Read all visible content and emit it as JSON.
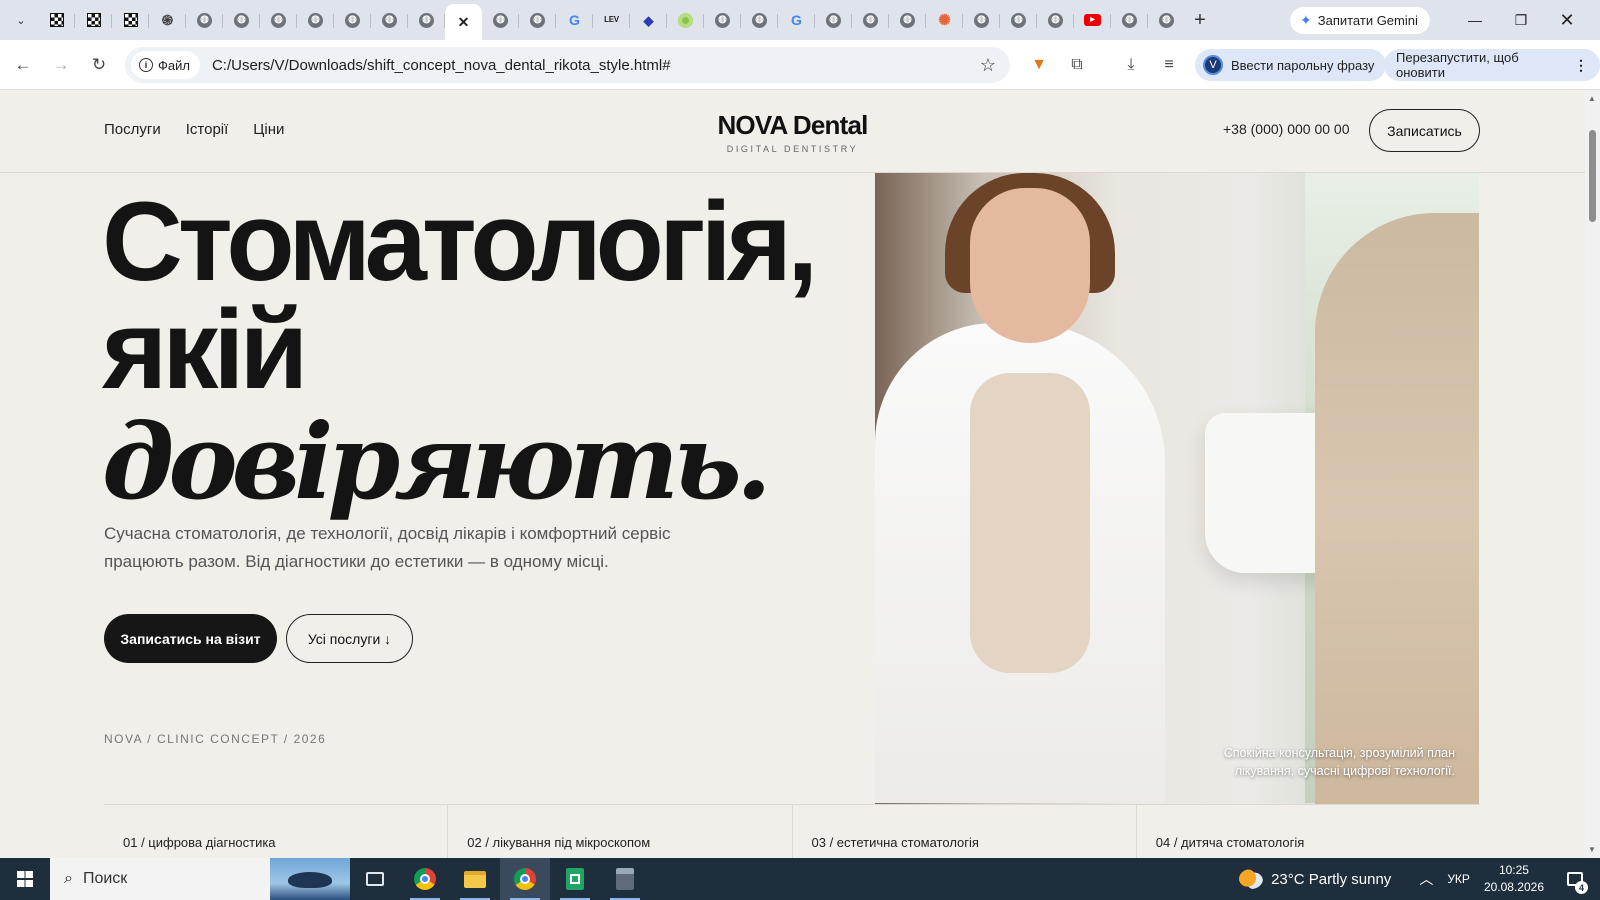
{
  "browser": {
    "tabs": [
      {
        "icon": "checker-favicon-icon"
      },
      {
        "icon": "checker-favicon-icon"
      },
      {
        "icon": "checker-favicon-icon"
      },
      {
        "icon": "spiral-favicon-icon"
      },
      {
        "icon": "globe-icon"
      },
      {
        "icon": "globe-icon"
      },
      {
        "icon": "globe-icon"
      },
      {
        "icon": "globe-icon"
      },
      {
        "icon": "globe-icon"
      },
      {
        "icon": "globe-icon"
      },
      {
        "icon": "globe-icon"
      },
      {
        "icon": "close-tab-icon",
        "active": true
      },
      {
        "icon": "globe-icon"
      },
      {
        "icon": "globe-icon"
      },
      {
        "icon": "google-g-icon"
      },
      {
        "icon": "lev-favicon-icon",
        "text": "LEV"
      },
      {
        "icon": "diamond-favicon-icon"
      },
      {
        "icon": "green-circle-favicon-icon"
      },
      {
        "icon": "globe-icon"
      },
      {
        "icon": "globe-icon"
      },
      {
        "icon": "google-g-icon"
      },
      {
        "icon": "globe-icon"
      },
      {
        "icon": "globe-icon"
      },
      {
        "icon": "globe-icon"
      },
      {
        "icon": "sunburst-favicon-icon"
      },
      {
        "icon": "globe-icon"
      },
      {
        "icon": "globe-icon"
      },
      {
        "icon": "globe-icon"
      },
      {
        "icon": "youtube-icon"
      },
      {
        "icon": "globe-icon"
      },
      {
        "icon": "globe-icon"
      }
    ],
    "gemini_label": "Запитати Gemini",
    "site_chip_label": "Файл",
    "url": "C:/Users/V/Downloads/shift_concept_nova_dental_rikota_style.html#",
    "passphrase_label": "Ввести парольну фразу",
    "profile_initial": "V",
    "restart_label": "Перезапустити, щоб оновити"
  },
  "site": {
    "nav": [
      "Послуги",
      "Історії",
      "Ціни"
    ],
    "logo": "NOVA Dental",
    "logo_sub": "DIGITAL DENTISTRY",
    "phone": "+38 (000) 000 00 00",
    "header_cta": "Записатись",
    "hero": {
      "line1": "Стоматологія,",
      "line2": "якій",
      "line3": "довіряють.",
      "description": "Сучасна стоматологія, де технології, досвід лікарів і комфортний сервіс працюють разом. Від діагностики до естетики — в одному місці.",
      "primary_cta": "Записатись на візит",
      "secondary_cta": "Усі послуги ↓",
      "meta": "NOVA / CLINIC CONCEPT / 2026",
      "photo_caption": "Спокійна консультація, зрозумілий план лікування, сучасні цифрові технології."
    },
    "services": [
      "01 / цифрова діагностика",
      "02 / лікування під мікроскопом",
      "03 / естетична стоматологія",
      "04 / дитяча стоматологія"
    ]
  },
  "taskbar": {
    "search_label": "Поиск",
    "weather": "23°C  Partly sunny",
    "language": "УКР",
    "time": "10:25",
    "date": "20.08.2026",
    "notifications": "4"
  },
  "colors": {
    "page_bg": "#f1efea",
    "text_dark": "#151515",
    "taskbar_bg": "#1f2e3d",
    "tabbar_bg": "#dfe3eb"
  }
}
